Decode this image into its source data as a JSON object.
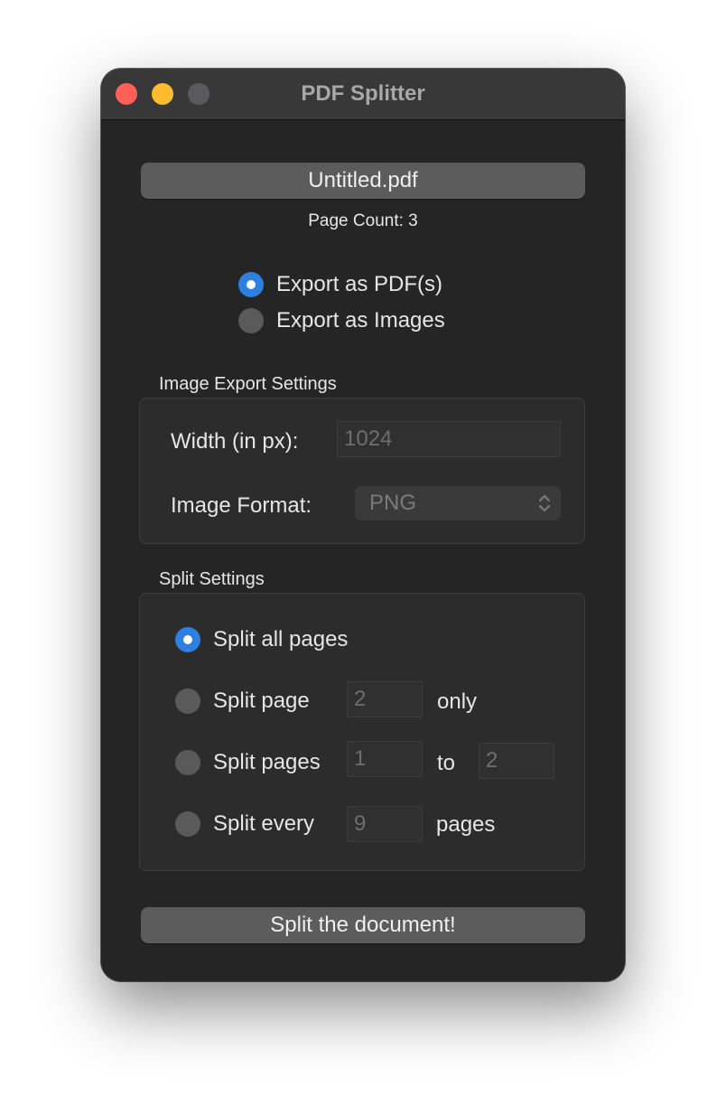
{
  "window": {
    "title": "PDF Splitter"
  },
  "file": {
    "button_label": "Untitled.pdf",
    "page_count_text": "Page Count: 3"
  },
  "export_mode": {
    "options": [
      {
        "label": "Export as PDF(s)",
        "selected": true
      },
      {
        "label": "Export as Images",
        "selected": false
      }
    ]
  },
  "image_export": {
    "section_title": "Image Export Settings",
    "width_label": "Width (in px):",
    "width_placeholder": "1024",
    "format_label": "Image Format:",
    "format_value": "PNG"
  },
  "split_settings": {
    "section_title": "Split Settings",
    "all_pages": {
      "label": "Split all pages",
      "selected": true
    },
    "single_page": {
      "label": "Split page",
      "value": "2",
      "suffix": "only",
      "selected": false
    },
    "range": {
      "label": "Split pages",
      "from": "1",
      "between": "to",
      "to": "2",
      "selected": false
    },
    "every": {
      "label": "Split every",
      "value": "9",
      "suffix": "pages",
      "selected": false
    }
  },
  "actions": {
    "split_button_label": "Split the document!"
  },
  "colors": {
    "window_bg": "#252526",
    "accent": "#2d7fe0",
    "close": "#fe5f57",
    "minimize": "#febc2e",
    "zoom_disabled": "#5a5a5c"
  }
}
